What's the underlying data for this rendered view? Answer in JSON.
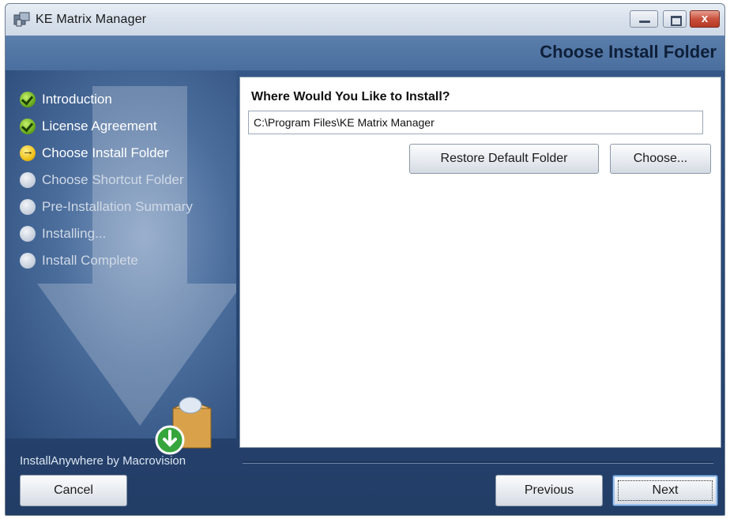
{
  "window": {
    "title": "KE Matrix Manager",
    "controls": {
      "minimize_icon": "minimize-icon",
      "maximize_icon": "maximize-icon",
      "close_label": "x"
    }
  },
  "header": {
    "title": "Choose Install Folder"
  },
  "sidebar": {
    "steps": [
      {
        "label": "Introduction",
        "state": "done"
      },
      {
        "label": "License Agreement",
        "state": "done"
      },
      {
        "label": "Choose Install Folder",
        "state": "current"
      },
      {
        "label": "Choose Shortcut Folder",
        "state": "pending"
      },
      {
        "label": "Pre-Installation Summary",
        "state": "pending"
      },
      {
        "label": "Installing...",
        "state": "pending"
      },
      {
        "label": "Install Complete",
        "state": "pending"
      }
    ]
  },
  "content": {
    "question": "Where Would You Like to Install?",
    "path_value": "C:\\Program Files\\KE Matrix Manager",
    "restore_label": "Restore Default Folder",
    "choose_label": "Choose..."
  },
  "footer": {
    "brand": "InstallAnywhere by Macrovision",
    "cancel_label": "Cancel",
    "previous_label": "Previous",
    "next_label": "Next"
  },
  "colors": {
    "accent": "#2c4c7a",
    "panel": "#ffffff",
    "heading": "#0e1f38"
  }
}
